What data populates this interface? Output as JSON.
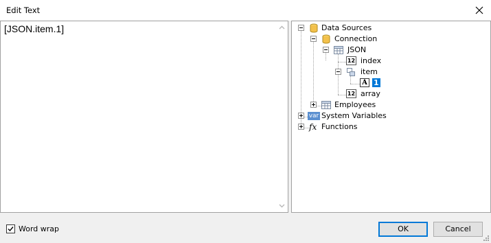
{
  "window": {
    "title": "Edit Text"
  },
  "editor": {
    "text": "[JSON.item.1]"
  },
  "tree": {
    "data_sources": "Data Sources",
    "connection": "Connection",
    "json": "JSON",
    "index": "index",
    "item": "item",
    "item_child": "1",
    "array": "array",
    "employees": "Employees",
    "system_variables": "System Variables",
    "functions": "Functions",
    "badge_12": "12",
    "badge_var": "var",
    "badge_a": "A",
    "badge_fx": "fx"
  },
  "footer": {
    "word_wrap_label": "Word wrap",
    "word_wrap_checked": true,
    "ok_label": "OK",
    "cancel_label": "Cancel"
  },
  "colors": {
    "selection": "#0078d7",
    "db_icon": "#f3c14b"
  }
}
